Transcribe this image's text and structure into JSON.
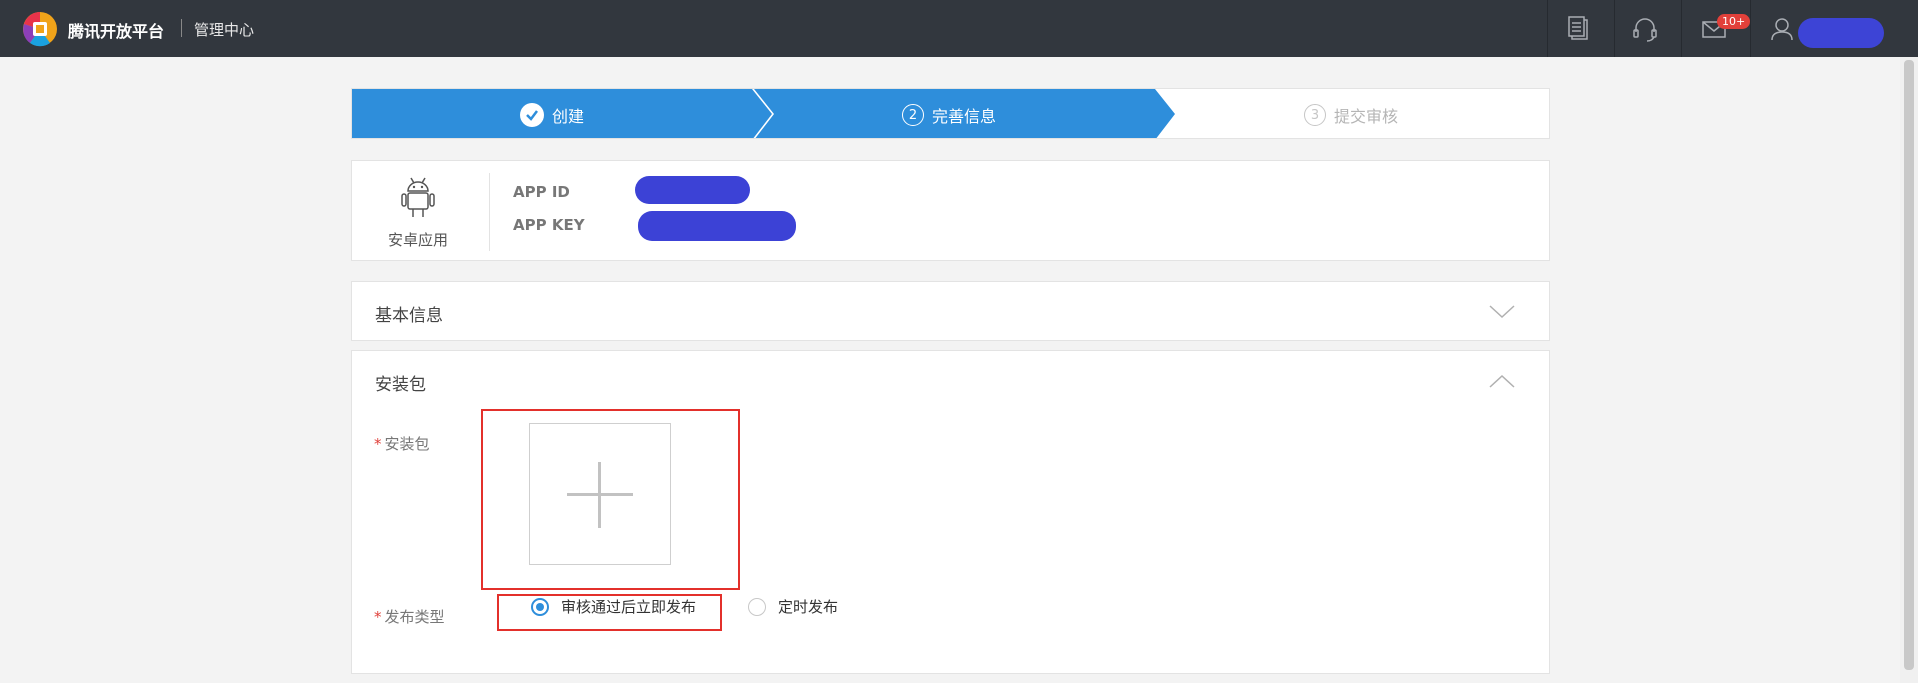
{
  "header": {
    "brand": "腾讯开放平台",
    "subtitle": "管理中心",
    "notification_badge": "10+",
    "icons": [
      "document-icon",
      "headset-icon",
      "mail-icon",
      "user-icon"
    ]
  },
  "steps": [
    {
      "label": "创建",
      "state": "done"
    },
    {
      "number": "2",
      "label": "完善信息",
      "state": "active"
    },
    {
      "number": "3",
      "label": "提交审核",
      "state": "pending"
    }
  ],
  "app_info": {
    "platform_label": "安卓应用",
    "app_id_label": "APP ID",
    "app_key_label": "APP KEY"
  },
  "sections": {
    "basic_info": "基本信息",
    "package": "安装包"
  },
  "form": {
    "required_mark": "*",
    "package_label": "安装包",
    "publish_type_label": "发布类型",
    "publish_options": [
      "审核通过后立即发布",
      "定时发布"
    ],
    "selected_option": "审核通过后立即发布"
  },
  "colors": {
    "topbar": "#32373e",
    "step_active": "#2e8edb",
    "mask": "#3c42d6",
    "highlight": "#e3302b",
    "required": "#e0403a"
  }
}
